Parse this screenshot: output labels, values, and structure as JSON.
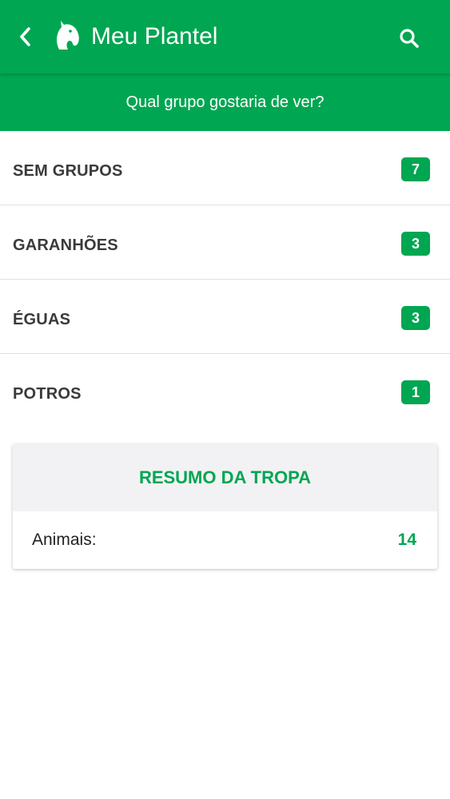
{
  "app_bar": {
    "title": "Meu Plantel",
    "back_icon": "chevron-left-icon",
    "logo_icon": "horse-head-icon",
    "search_icon": "search-icon"
  },
  "subheader": {
    "prompt": "Qual grupo gostaria de ver?"
  },
  "groups": [
    {
      "label": "SEM GRUPOS",
      "count": "7"
    },
    {
      "label": "GARANHÕES",
      "count": "3"
    },
    {
      "label": "ÉGUAS",
      "count": "3"
    },
    {
      "label": "POTROS",
      "count": "1"
    }
  ],
  "summary": {
    "title": "RESUMO DA TROPA",
    "animals_label": "Animais:",
    "animals_value": "14"
  },
  "colors": {
    "primary": "#00a651",
    "card_header_bg": "#f2f2f4",
    "text_dark": "#3a3a3a"
  }
}
